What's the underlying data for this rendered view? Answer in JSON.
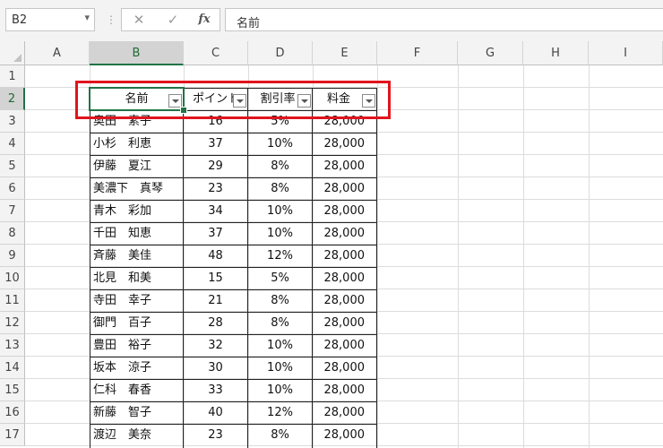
{
  "formula_bar": {
    "name_box": "B2",
    "formula": "名前"
  },
  "columns": [
    "A",
    "B",
    "C",
    "D",
    "E",
    "F",
    "G",
    "H",
    "I"
  ],
  "rows": [
    "1",
    "2",
    "3",
    "4",
    "5",
    "6",
    "7",
    "8",
    "9",
    "10",
    "11",
    "12",
    "13",
    "14",
    "15",
    "16",
    "17"
  ],
  "table": {
    "headers": [
      "名前",
      "ポイント",
      "割引率",
      "料金"
    ],
    "rows": [
      [
        "奥田　素子",
        "16",
        "5%",
        "28,000"
      ],
      [
        "小杉　利恵",
        "37",
        "10%",
        "28,000"
      ],
      [
        "伊藤　夏江",
        "29",
        "8%",
        "28,000"
      ],
      [
        "美濃下　真琴",
        "23",
        "8%",
        "28,000"
      ],
      [
        "青木　彩加",
        "34",
        "10%",
        "28,000"
      ],
      [
        "千田　知恵",
        "37",
        "10%",
        "28,000"
      ],
      [
        "斉藤　美佳",
        "48",
        "12%",
        "28,000"
      ],
      [
        "北見　和美",
        "15",
        "5%",
        "28,000"
      ],
      [
        "寺田　幸子",
        "21",
        "8%",
        "28,000"
      ],
      [
        "御門　百子",
        "28",
        "8%",
        "28,000"
      ],
      [
        "豊田　裕子",
        "32",
        "10%",
        "28,000"
      ],
      [
        "坂本　涼子",
        "30",
        "10%",
        "28,000"
      ],
      [
        "仁科　春香",
        "33",
        "10%",
        "28,000"
      ],
      [
        "新藤　智子",
        "40",
        "12%",
        "28,000"
      ],
      [
        "渡辺　美奈",
        "23",
        "8%",
        "28,000"
      ]
    ]
  },
  "selected_cell": "B2",
  "colors": {
    "accent": "#217346",
    "highlight": "#e0141e"
  },
  "icons": [
    "cancel-icon",
    "enter-check-icon",
    "function-fx-icon",
    "dropdown-arrow-icon",
    "filter-dropdown-icon"
  ]
}
